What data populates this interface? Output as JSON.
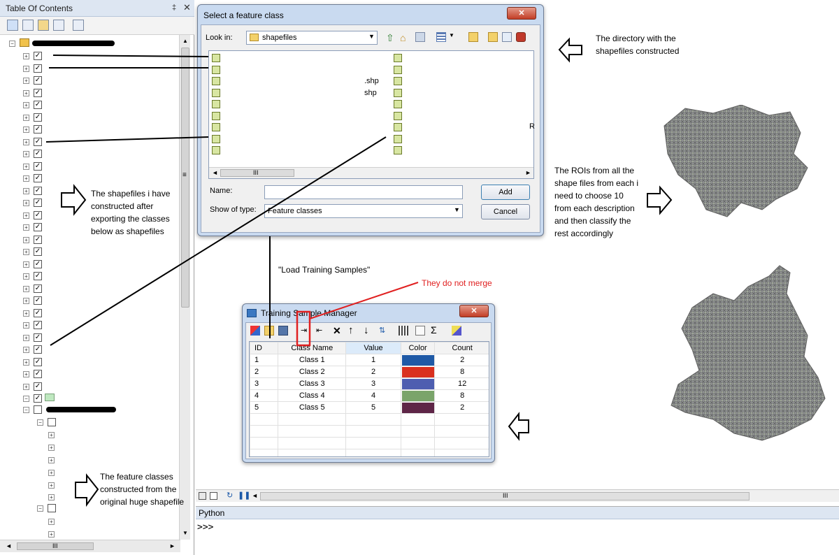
{
  "toc": {
    "title": "Table Of Contents",
    "pin": "‡",
    "close": "✕",
    "scroll_thumb_mark": "≡",
    "h_scroll": "III"
  },
  "select_dialog": {
    "title": "Select a feature class",
    "close": "✕",
    "look_in_label": "Look in:",
    "look_in_value": "shapefiles",
    "file_suffixes": [
      ".shp",
      "shp"
    ],
    "right_char": "R",
    "h_scroll": "III",
    "name_label": "Name:",
    "name_value": "",
    "show_type_label": "Show of type:",
    "show_type_value": "Feature classes",
    "add_label": "Add",
    "cancel_label": "Cancel"
  },
  "training_manager": {
    "title": "Training Sample Manager",
    "close": "✕",
    "columns": [
      "ID",
      "Class Name",
      "Value",
      "Color",
      "Count"
    ],
    "rows": [
      {
        "id": "1",
        "name": "Class 1",
        "value": "1",
        "color": "#1f5aa6",
        "count": "2"
      },
      {
        "id": "2",
        "name": "Class 2",
        "value": "2",
        "color": "#d9301e",
        "count": "8"
      },
      {
        "id": "3",
        "name": "Class 3",
        "value": "3",
        "color": "#4e5eb0",
        "count": "12"
      },
      {
        "id": "4",
        "name": "Class 4",
        "value": "4",
        "color": "#7aa46a",
        "count": "8"
      },
      {
        "id": "5",
        "name": "Class 5",
        "value": "5",
        "color": "#5e2547",
        "count": "2"
      }
    ]
  },
  "annotations": {
    "directory": "The directory with the shapefiles constructed",
    "shapefiles": "The shapefiles i have constructed after exporting the classes below as shapefiles",
    "rois": "The ROIs from all the shape files from each i need to choose 10 from each description and then classify the rest accordingly",
    "load_training": "\"Load Training Samples\"",
    "no_merge": "They do not merge",
    "feature_classes": "The feature classes constructed from the original huge shapefile"
  },
  "map": {
    "h_scroll": "III"
  },
  "python": {
    "title": "Python",
    "prompt": ">>>"
  },
  "colors": {
    "accent_red": "#e02020",
    "dialog_frame": "#c9daf0"
  }
}
